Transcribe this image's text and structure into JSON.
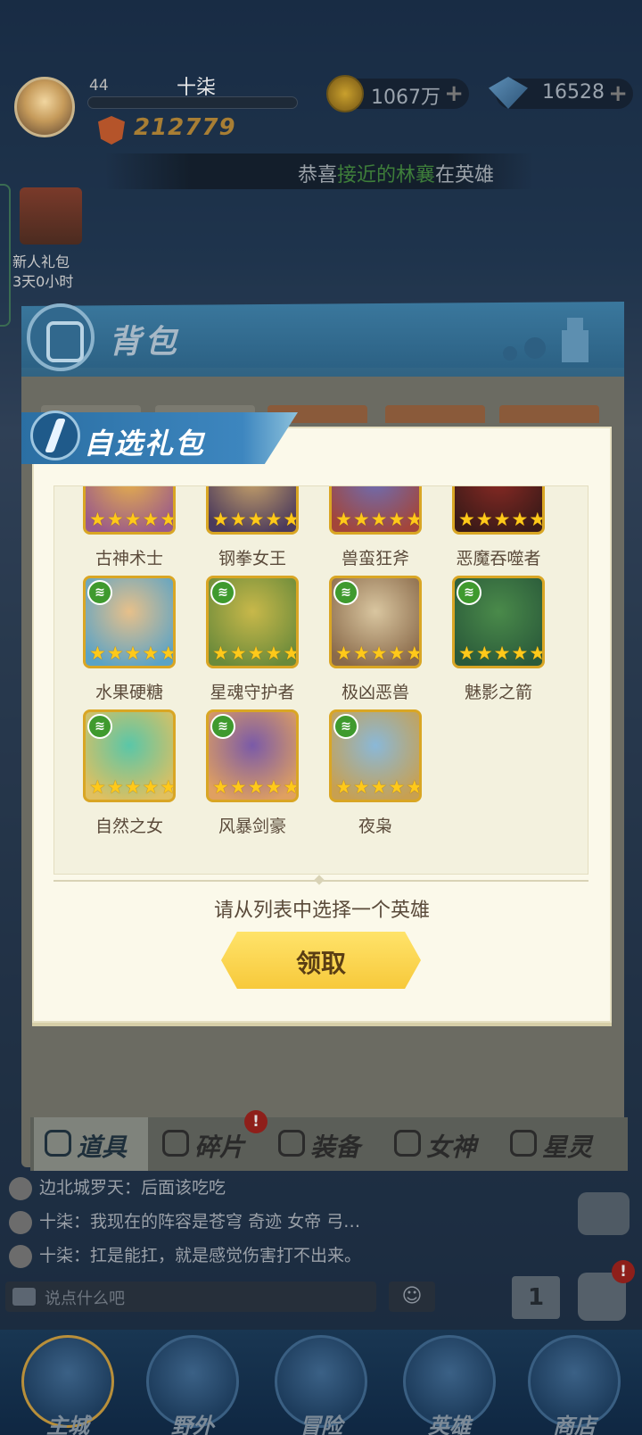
{
  "player": {
    "level": "44",
    "name": "十柒",
    "power": "212779"
  },
  "resources": {
    "gold": "1067万",
    "gems": "16528",
    "plus": "+"
  },
  "ticker": {
    "prefix": "恭喜",
    "highlight": "接近的林襄",
    "suffix": "在英雄"
  },
  "newbie_gift": {
    "title": "新人礼包",
    "timer": "3天0小时"
  },
  "bag": {
    "title": "背包",
    "tabs": [
      {
        "label": "道具",
        "icon": "item-icon",
        "active": true
      },
      {
        "label": "碎片",
        "icon": "shard-icon",
        "badge": "!"
      },
      {
        "label": "装备",
        "icon": "equipment-icon"
      },
      {
        "label": "女神",
        "icon": "goddess-icon"
      },
      {
        "label": "星灵",
        "icon": "star-spirit-icon"
      }
    ]
  },
  "modal": {
    "title": "自选礼包",
    "prompt": "请从列表中选择一个英雄",
    "claim_label": "领取",
    "heroes": [
      {
        "name": "古神术士",
        "stars": 5,
        "element_badge": false
      },
      {
        "name": "钢拳女王",
        "stars": 5,
        "element_badge": false
      },
      {
        "name": "兽蛮狂斧",
        "stars": 5,
        "element_badge": false
      },
      {
        "name": "恶魔吞噬者",
        "stars": 5,
        "element_badge": false
      },
      {
        "name": "水果硬糖",
        "stars": 5,
        "element_badge": true
      },
      {
        "name": "星魂守护者",
        "stars": 5,
        "element_badge": true
      },
      {
        "name": "极凶恶兽",
        "stars": 5,
        "element_badge": true
      },
      {
        "name": "魅影之箭",
        "stars": 5,
        "element_badge": true
      },
      {
        "name": "自然之女",
        "stars": 5,
        "element_badge": true
      },
      {
        "name": "风暴剑豪",
        "stars": 5,
        "element_badge": true
      },
      {
        "name": "夜枭",
        "stars": 5,
        "element_badge": true
      }
    ]
  },
  "chat": {
    "messages": [
      {
        "sender": "边北城罗天",
        "text": "后面该吃吃"
      },
      {
        "sender": "十柒",
        "text": "我现在的阵容是苍穹 奇迹 女帝 弓…"
      },
      {
        "sender": "十柒",
        "text": "扛是能扛，就是感觉伤害打不出来。"
      }
    ],
    "input_placeholder": "说点什么吧",
    "rank_label": "1",
    "bag_badge": "!"
  },
  "nav": [
    {
      "label": "主城",
      "active": true
    },
    {
      "label": "野外"
    },
    {
      "label": "冒险"
    },
    {
      "label": "英雄"
    },
    {
      "label": "商店"
    }
  ],
  "colors": {
    "accent_gold": "#f7c93b",
    "modal_bg": "#fbf9ea",
    "header_blue": "#2b6fa3"
  }
}
